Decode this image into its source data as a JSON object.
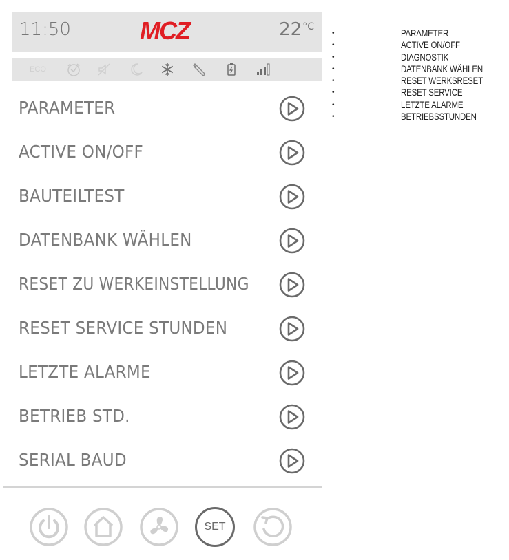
{
  "status": {
    "time": "11:50",
    "brand": "MCZ",
    "temperature": "22",
    "temperature_unit": "°C"
  },
  "status_icons": [
    "eco-icon",
    "clock-icon",
    "mute-icon",
    "moon-icon",
    "snowflake-icon",
    "wrench-icon",
    "battery-icon",
    "signal-icon"
  ],
  "status_icons_text": {
    "eco": "ECO"
  },
  "menu": {
    "items": [
      {
        "label": "PARAMETER"
      },
      {
        "label": "ACTIVE ON/OFF"
      },
      {
        "label": "BAUTEILTEST"
      },
      {
        "label": "DATENBANK WÄHLEN"
      },
      {
        "label": "RESET ZU WERKEINSTELLUNG"
      },
      {
        "label": "RESET SERVICE STUNDEN"
      },
      {
        "label": "LETZTE ALARME"
      },
      {
        "label": "BETRIEB STD."
      },
      {
        "label": "SERIAL BAUD"
      }
    ]
  },
  "bottom_bar": {
    "buttons": [
      "power-icon",
      "home-icon",
      "fan-icon",
      "set-button",
      "back-icon"
    ],
    "set_label": "SET"
  },
  "notes": {
    "bullet": "•",
    "items": [
      "PARAMETER",
      "ACTIVE ON/OFF",
      "DIAGNOSTIK",
      "DATENBANK WÄHLEN",
      "RESET WERKSRESET",
      "RESET SERVICE",
      "LETZTE ALARME",
      "BETRIEBSSTUNDEN"
    ]
  },
  "colors": {
    "bar_bg": "#e4e4e4",
    "brand_red": "#e01e24",
    "text_gray": "#7a7a7a",
    "icon_gray": "#8a8a8a",
    "light_gray": "#cfcfcf"
  }
}
